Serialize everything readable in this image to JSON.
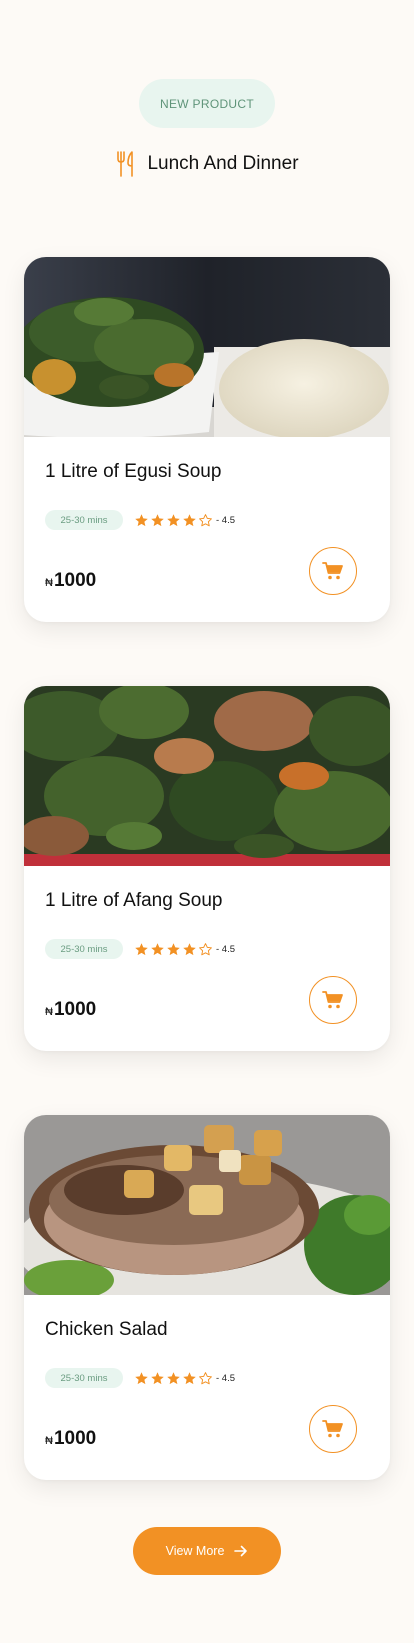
{
  "section": {
    "badge": "NEW PRODUCT",
    "title": "Lunch And Dinner",
    "icon": "fork-knife-icon"
  },
  "products": [
    {
      "name": "1 Litre of Egusi Soup",
      "time": "25-30 mins",
      "rating": 4,
      "rating_label": "- 4.5",
      "currency": "₦",
      "price": "1000",
      "image": "egusi-soup-with-pounded-yam"
    },
    {
      "name": "1 Litre of Afang Soup",
      "time": "25-30 mins",
      "rating": 4,
      "rating_label": "- 4.5",
      "currency": "₦",
      "price": "1000",
      "image": "afang-soup-vegetables"
    },
    {
      "name": "Chicken Salad",
      "time": "25-30 mins",
      "rating": 4,
      "rating_label": "- 4.5",
      "currency": "₦",
      "price": "1000",
      "image": "grilled-chicken-with-vegetables"
    }
  ],
  "view_more": {
    "label": "View More",
    "icon": "arrow-right-icon"
  },
  "colors": {
    "accent": "#f29124",
    "mint": "#e8f5ef",
    "mint_text": "#5f9479",
    "background": "#fdfaf6"
  }
}
